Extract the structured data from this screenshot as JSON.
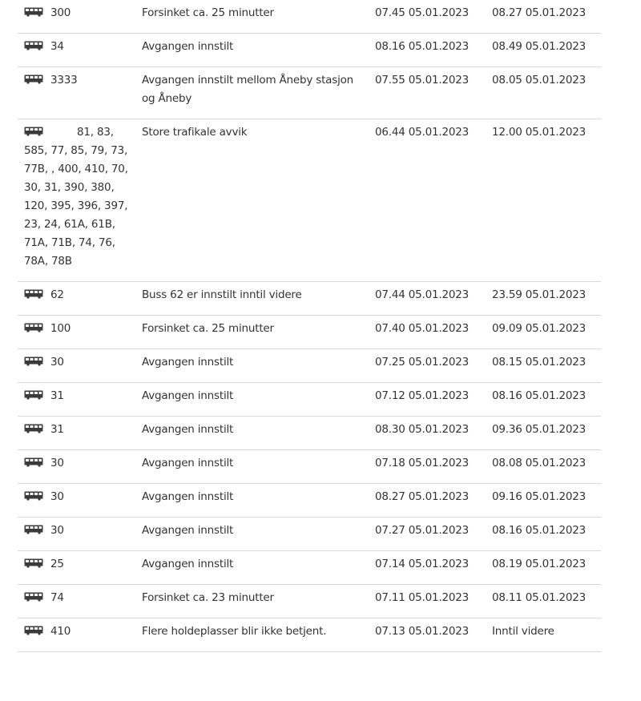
{
  "icon": "bus-icon",
  "rows": [
    {
      "line": "300",
      "desc": "Forsinket ca. 25 minutter",
      "from": "07.45 05.01.2023",
      "to": "08.27 05.01.2023"
    },
    {
      "line": "34",
      "desc": "Avgangen innstilt",
      "from": "08.16 05.01.2023",
      "to": "08.49 05.01.2023"
    },
    {
      "line": "3333",
      "desc": "Avgangen innstilt mellom Åneby stasjon og Åneby",
      "from": "07.55 05.01.2023",
      "to": "08.05 05.01.2023"
    },
    {
      "line": "81, 83, 585, 77, 85, 79, 73, 77B, , 400, 410, 70, 30, 31, 390, 380, 120, 395, 396, 397, 23, 24, 61A, 61B, 71A, 71B, 74, 76, 78A, 78B",
      "desc": "Store trafikale avvik",
      "from": "06.44 05.01.2023",
      "to": "12.00 05.01.2023"
    },
    {
      "line": "62",
      "desc": "Buss 62 er innstilt inntil videre",
      "from": "07.44 05.01.2023",
      "to": "23.59 05.01.2023"
    },
    {
      "line": "100",
      "desc": "Forsinket ca. 25 minutter",
      "from": "07.40 05.01.2023",
      "to": "09.09 05.01.2023"
    },
    {
      "line": "30",
      "desc": "Avgangen innstilt",
      "from": "07.25 05.01.2023",
      "to": "08.15 05.01.2023"
    },
    {
      "line": "31",
      "desc": "Avgangen innstilt",
      "from": "07.12 05.01.2023",
      "to": "08.16 05.01.2023"
    },
    {
      "line": "31",
      "desc": "Avgangen innstilt",
      "from": "08.30 05.01.2023",
      "to": "09.36 05.01.2023"
    },
    {
      "line": "30",
      "desc": "Avgangen innstilt",
      "from": "07.18 05.01.2023",
      "to": "08.08 05.01.2023"
    },
    {
      "line": "30",
      "desc": "Avgangen innstilt",
      "from": "08.27 05.01.2023",
      "to": "09.16 05.01.2023"
    },
    {
      "line": "30",
      "desc": "Avgangen innstilt",
      "from": "07.27 05.01.2023",
      "to": "08.16 05.01.2023"
    },
    {
      "line": "25",
      "desc": "Avgangen innstilt",
      "from": "07.14 05.01.2023",
      "to": "08.19 05.01.2023"
    },
    {
      "line": "74",
      "desc": "Forsinket ca. 23 minutter",
      "from": "07.11 05.01.2023",
      "to": "08.11 05.01.2023"
    },
    {
      "line": "410",
      "desc": "Flere holdeplasser blir ikke betjent.",
      "from": "07.13 05.01.2023",
      "to": "Inntil videre"
    }
  ]
}
